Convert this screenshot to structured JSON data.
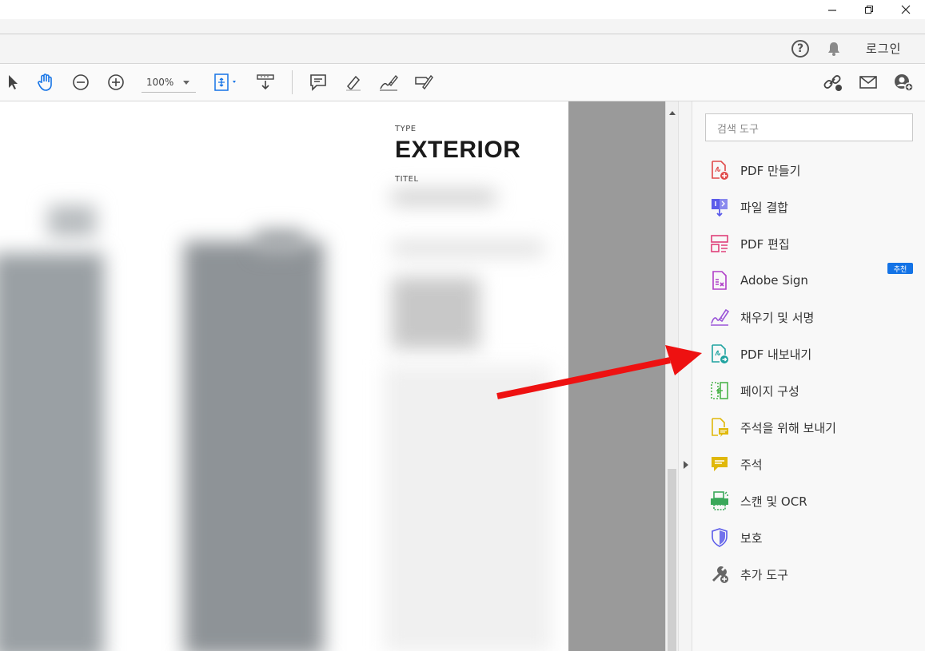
{
  "window": {
    "minimize_icon": "minimize-icon",
    "restore_icon": "restore-icon",
    "close_icon": "close-icon"
  },
  "account": {
    "help_symbol": "?",
    "login_label": "로그인"
  },
  "toolbar": {
    "zoom_value": "100%"
  },
  "document": {
    "type_label": "TYPE",
    "title": "EXTERIOR",
    "titel_label": "TITEL"
  },
  "panel": {
    "search_placeholder": "검색 도구",
    "recommended_badge": "추천",
    "tools": [
      {
        "label": "PDF 만들기",
        "icon": "create-pdf-icon",
        "color": "#e04a4a"
      },
      {
        "label": "파일 결합",
        "icon": "combine-files-icon",
        "color": "#5b5bea"
      },
      {
        "label": "PDF 편집",
        "icon": "edit-pdf-icon",
        "color": "#e0407a"
      },
      {
        "label": "Adobe Sign",
        "icon": "adobe-sign-icon",
        "color": "#b040c8"
      },
      {
        "label": "채우기 및 서명",
        "icon": "fill-sign-icon",
        "color": "#9a55d8"
      },
      {
        "label": "PDF 내보내기",
        "icon": "export-pdf-icon",
        "color": "#1fa3a0"
      },
      {
        "label": "페이지 구성",
        "icon": "organize-pages-icon",
        "color": "#4cb44c"
      },
      {
        "label": "주석을 위해 보내기",
        "icon": "send-for-comments-icon",
        "color": "#e0b80a"
      },
      {
        "label": "주석",
        "icon": "comment-icon",
        "color": "#e0b80a"
      },
      {
        "label": "스캔 및 OCR",
        "icon": "scan-ocr-icon",
        "color": "#3aa85a"
      },
      {
        "label": "보호",
        "icon": "protect-icon",
        "color": "#5b5bea"
      },
      {
        "label": "추가 도구",
        "icon": "more-tools-icon",
        "color": "#666666"
      }
    ]
  },
  "colors": {
    "accent": "#1473e6",
    "annotation_arrow": "#ee1111"
  }
}
